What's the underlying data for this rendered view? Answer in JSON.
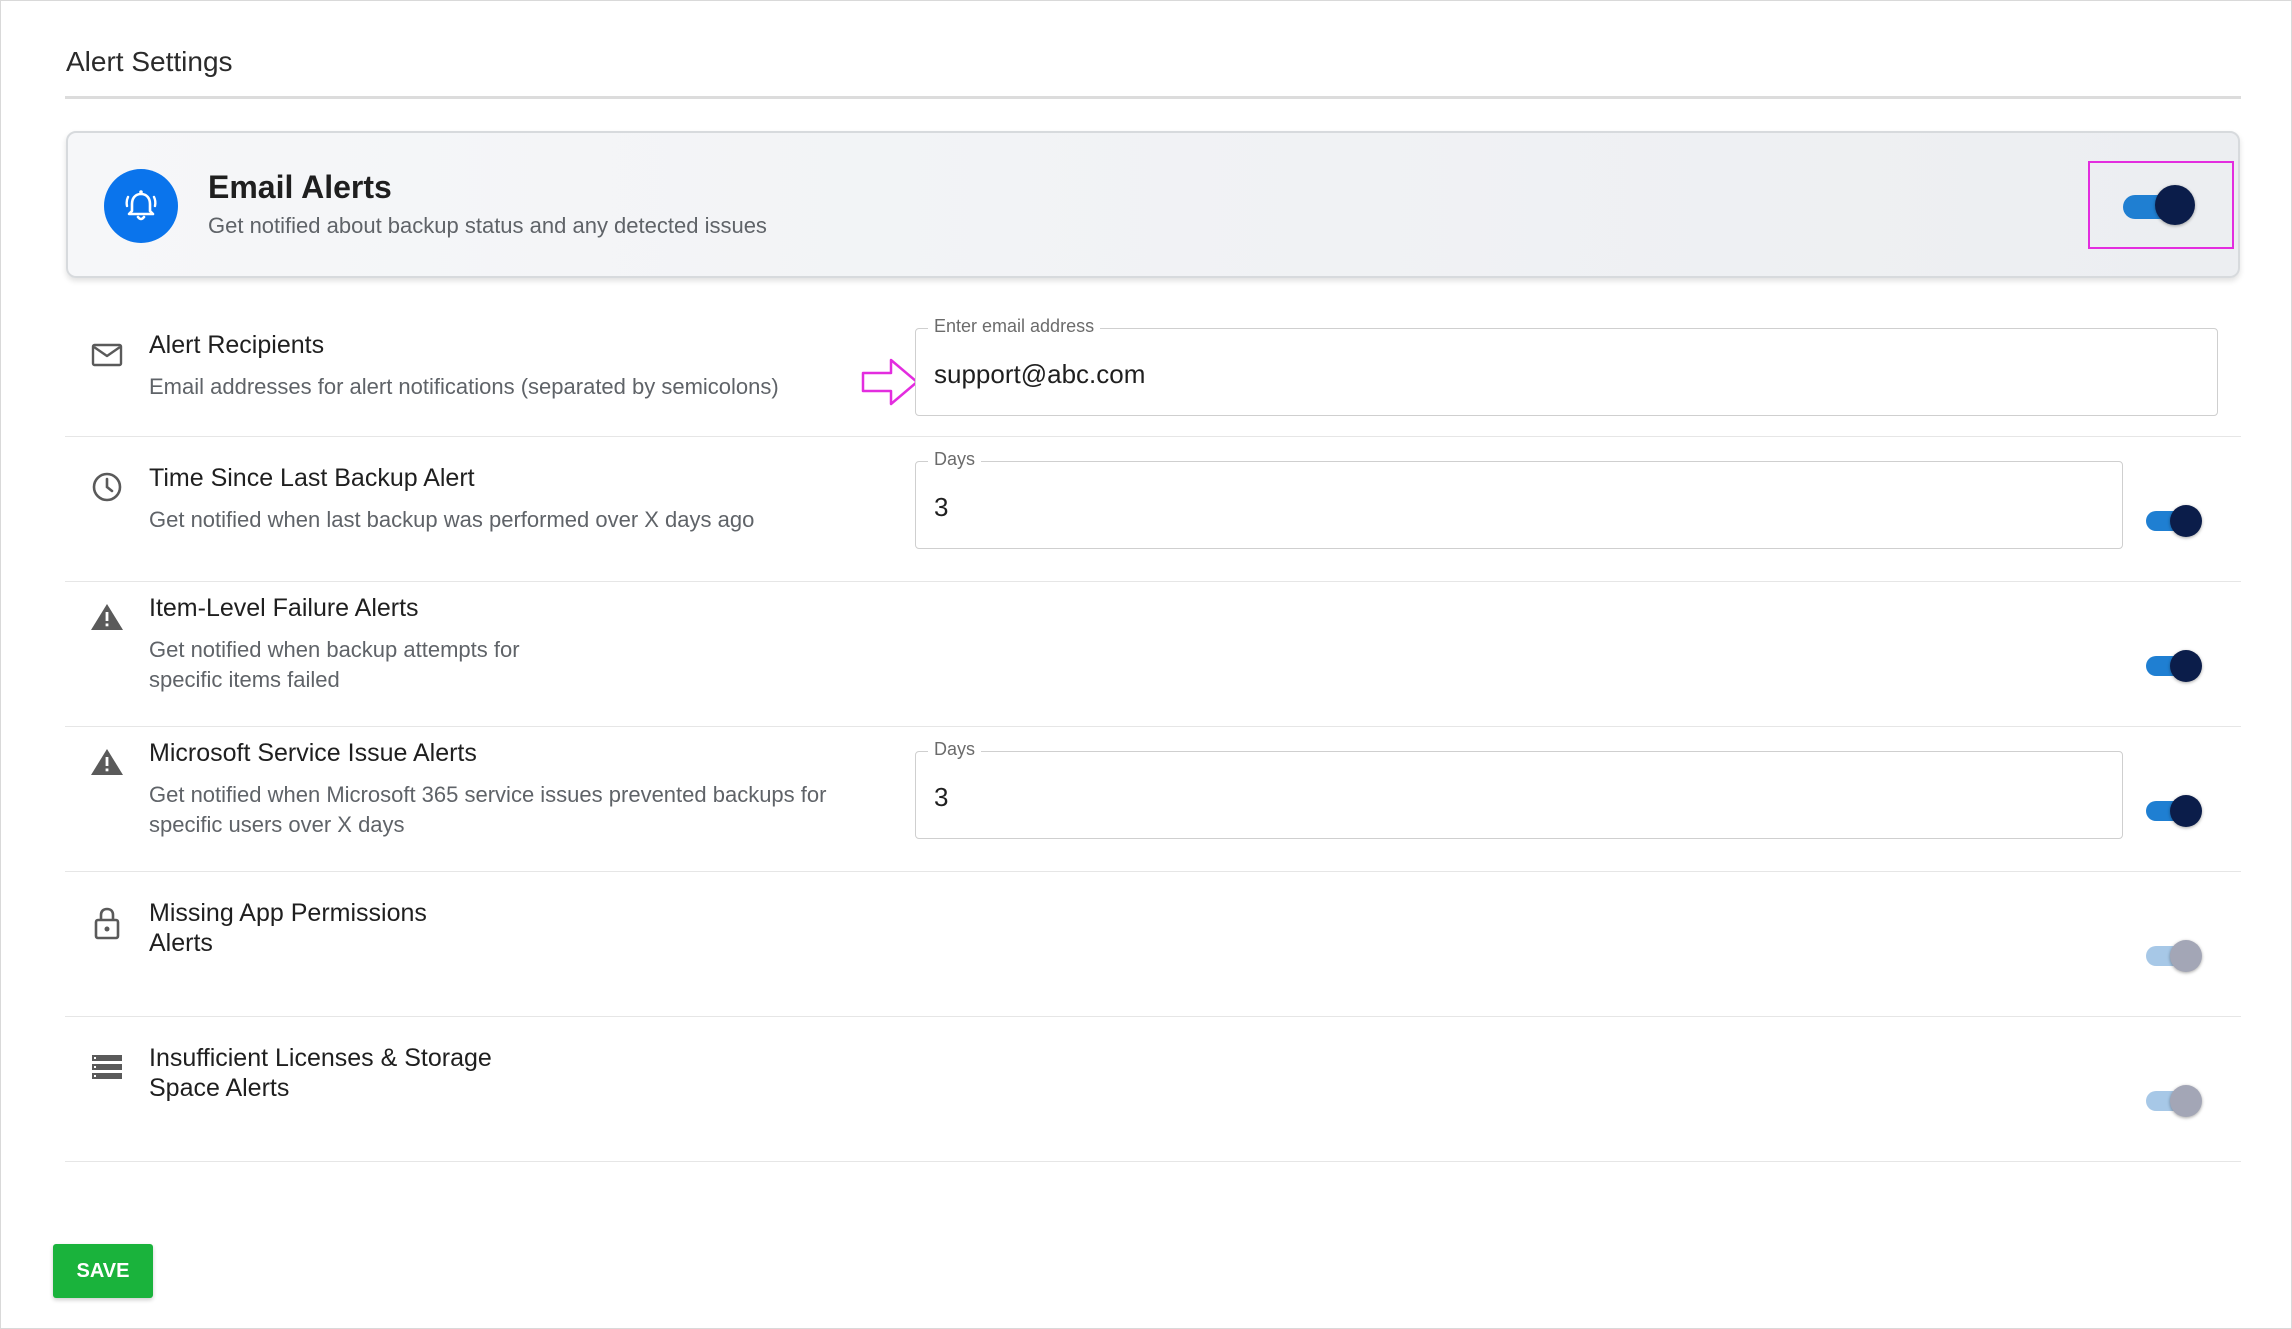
{
  "page": {
    "title": "Alert Settings"
  },
  "email_alerts": {
    "title": "Email Alerts",
    "subtitle": "Get notified about backup status and any detected issues",
    "icon": "bell-icon",
    "enabled": true
  },
  "rows": [
    {
      "icon": "mail-icon",
      "title": "Alert Recipients",
      "description": "Email addresses for alert notifications (separated by semicolons)",
      "field": {
        "label": "Enter email address",
        "value": "support@abc.com"
      }
    },
    {
      "icon": "clock-icon",
      "title": "Time Since Last Backup Alert",
      "description": "Get notified when last backup was performed over X days ago",
      "field": {
        "label": "Days",
        "value": "3"
      },
      "enabled": true
    },
    {
      "icon": "warning-icon",
      "title": "Item-Level Failure Alerts",
      "description_lines": [
        "Get notified when backup attempts for",
        "specific items failed"
      ],
      "enabled": true
    },
    {
      "icon": "warning-icon",
      "title": "Microsoft Service Issue Alerts",
      "description_lines": [
        "Get notified when Microsoft 365 service issues prevented backups for",
        "specific users over X days"
      ],
      "field": {
        "label": "Days",
        "value": "3"
      },
      "enabled": true
    },
    {
      "icon": "lock-icon",
      "title_lines": [
        "Missing App Permissions",
        "Alerts"
      ],
      "enabled": false
    },
    {
      "icon": "storage-icon",
      "title_lines": [
        "Insufficient Licenses & Storage",
        "Space Alerts"
      ],
      "enabled": false
    }
  ],
  "save_label": "SAVE",
  "colors": {
    "accent": "#0a74ec",
    "highlight": "#e32ddf",
    "save": "#1ab33c",
    "toggle_on": "#1f7fd2",
    "knob_on": "#0b1d4a"
  }
}
